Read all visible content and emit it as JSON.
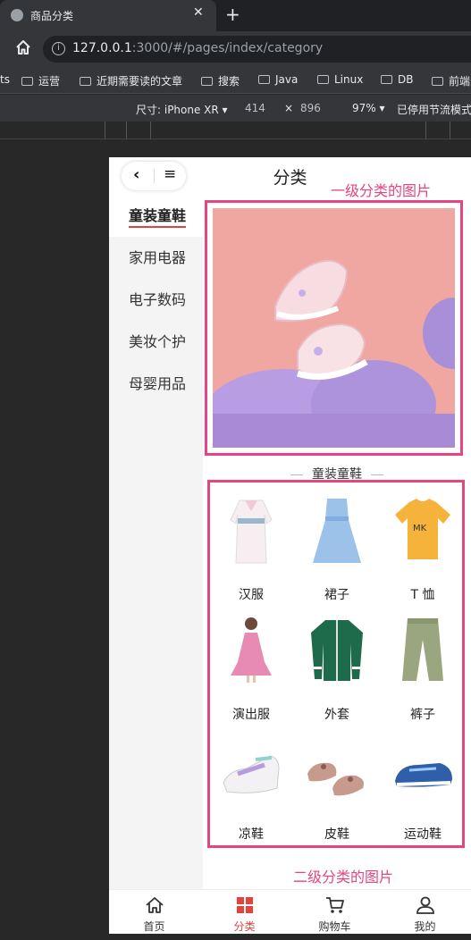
{
  "browser": {
    "tab_title": "商品分类",
    "new_tab": "+",
    "close": "✕",
    "url_host": "127.0.0.1",
    "url_path": ":3000/#/pages/index/category",
    "bookmarks": [
      "ts",
      "运营",
      "近期需要读的文章",
      "搜索",
      "Java",
      "Linux",
      "DB",
      "前端"
    ],
    "device": {
      "size_label": "尺寸: iPhone XR ▾",
      "width": "414",
      "x": "×",
      "height": "896",
      "zoom": "97% ▾",
      "throttle": "已停用节流模式"
    }
  },
  "app": {
    "nav_title": "分类",
    "capsule_back": "‹",
    "capsule_menu": "≡",
    "annotation_top": "一级分类的图片",
    "annotation_bottom": "二级分类的图片",
    "categories": [
      {
        "label": "童装童鞋",
        "active": true
      },
      {
        "label": "家用电器",
        "active": false
      },
      {
        "label": "电子数码",
        "active": false
      },
      {
        "label": "美妆个护",
        "active": false
      },
      {
        "label": "母婴用品",
        "active": false
      }
    ],
    "section_title": "童装童鞋",
    "subcategories": [
      {
        "label": "汉服"
      },
      {
        "label": "裙子"
      },
      {
        "label": "T 恤"
      },
      {
        "label": "演出服"
      },
      {
        "label": "外套"
      },
      {
        "label": "裤子"
      },
      {
        "label": "凉鞋"
      },
      {
        "label": "皮鞋"
      },
      {
        "label": "运动鞋"
      }
    ],
    "tabs": [
      {
        "label": "首页",
        "active": false
      },
      {
        "label": "分类",
        "active": true
      },
      {
        "label": "购物车",
        "active": false
      },
      {
        "label": "我的",
        "active": false
      }
    ]
  },
  "colors": {
    "accent": "#e0443e",
    "annotation": "#e64482",
    "banner_bg": "#f0a7a1"
  }
}
